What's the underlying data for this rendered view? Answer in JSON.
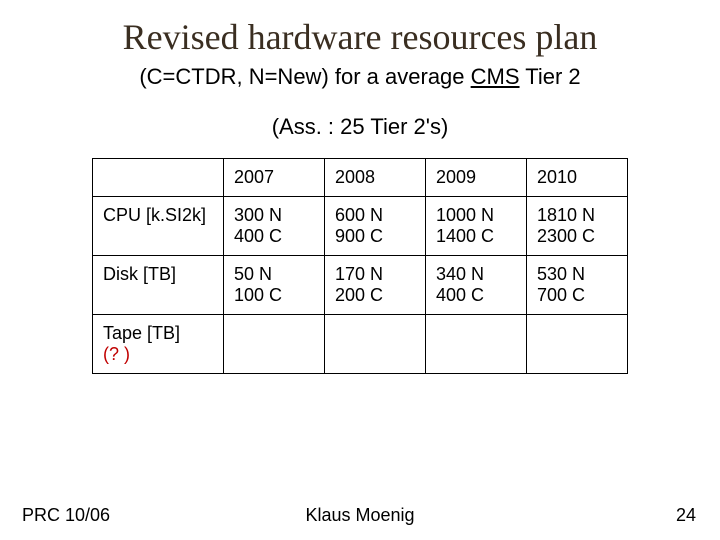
{
  "title": "Revised hardware resources plan",
  "subtitle_prefix": "(C=CTDR, N=New)  for a average ",
  "subtitle_underlined": "CMS",
  "subtitle_suffix": " Tier 2",
  "assumption": "(Ass. : 25 Tier 2's)",
  "table": {
    "years": [
      "2007",
      "2008",
      "2009",
      "2010"
    ],
    "rows": [
      {
        "label": "CPU [k.SI2k]",
        "cells": [
          {
            "n": "300 N",
            "c": "400 C"
          },
          {
            "n": "600 N",
            "c": "900 C"
          },
          {
            "n": "1000 N",
            "c": "1400 C"
          },
          {
            "n": "1810 N",
            "c": "2300 C"
          }
        ]
      },
      {
        "label": "Disk [TB]",
        "cells": [
          {
            "n": "50 N",
            "c": "100 C"
          },
          {
            "n": "170 N",
            "c": "200 C"
          },
          {
            "n": "340 N",
            "c": "400 C"
          },
          {
            "n": "530 N",
            "c": "700 C"
          }
        ]
      },
      {
        "label_a": "Tape [TB]",
        "label_b": "(? )",
        "cells": [
          {
            "n": "",
            "c": ""
          },
          {
            "n": "",
            "c": ""
          },
          {
            "n": "",
            "c": ""
          },
          {
            "n": "",
            "c": ""
          }
        ]
      }
    ]
  },
  "footer": {
    "left": "PRC 10/06",
    "center": "Klaus Moenig",
    "right": "24"
  }
}
